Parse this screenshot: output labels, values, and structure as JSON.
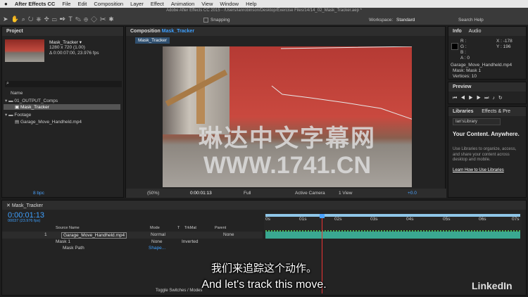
{
  "menubar": {
    "apple": "",
    "app": "After Effects CC",
    "items": [
      "File",
      "Edit",
      "Composition",
      "Layer",
      "Effect",
      "Animation",
      "View",
      "Window",
      "Help"
    ]
  },
  "window_title": "Adobe After Effects CC 2015 - /Users/ianrobinson/Desktop/Exercise Files/14/14_02_Mask_Tracker.aep *",
  "toolbar": {
    "snapping": "Snapping",
    "workspace_label": "Workspace:",
    "workspace_value": "Standard",
    "search_help": "Search Help"
  },
  "project": {
    "title": "Project",
    "item_name": "Mask_Tracker ▾",
    "item_res": "1280 x 720 (1.00)",
    "item_time": "Δ 0:00:07:00, 23.976 fps",
    "search_placeholder": "⌕",
    "col_name": "Name",
    "tree": [
      "01_OUTPUT_Comps",
      "Mask_Tracker",
      "Footage",
      "Garage_Move_Handheld.mp4"
    ],
    "bpc": "8 bpc"
  },
  "composition": {
    "tab_label": "Composition",
    "tab_name": "Mask_Tracker",
    "breadcrumb": "Mask_Tracker",
    "zoom": "(50%)",
    "timecode": "0:00:01:13",
    "quality": "Full",
    "camera": "Active Camera",
    "views": "1 View",
    "exposure": "+0.0"
  },
  "info": {
    "tab_info": "Info",
    "tab_audio": "Audio",
    "r": "R :",
    "g": "G :",
    "b": "B :",
    "a": "A : 0",
    "x": "X : -178",
    "y": "Y : 196",
    "file": "Garage_Move_Handheld.mp4",
    "mask": "Mask: Mask 1",
    "vertices": "Vertices: 10"
  },
  "preview": {
    "title": "Preview"
  },
  "libraries": {
    "title": "Libraries",
    "tab2": "Effects & Pre",
    "library": "Ian'sLibrary",
    "heading": "Your Content. Anywhere.",
    "body": "Use Libraries to organize, access, and share your content across desktop and mobile.",
    "link": "Learn How to Use Libraries"
  },
  "timeline": {
    "tab": "Mask_Tracker",
    "timecode": "0:00:01:13",
    "frames": "00037 (23.976 fps)",
    "col_source": "Source Name",
    "col_mode": "Mode",
    "col_t": "T",
    "col_trkmat": "TrkMat",
    "col_parent": "Parent",
    "layer_num": "1",
    "layer_name": "Garage_Move_Handheld.mp4",
    "layer_mode": "Normal",
    "parent_value": "None",
    "mask_name": "Mask 1",
    "mask_mode": "None",
    "inverted": "Inverted",
    "mask_path": "Mask Path",
    "shape": "Shape...",
    "toggle": "Toggle Switches / Modes",
    "ruler": [
      "0s",
      "01s",
      "02s",
      "03s",
      "04s",
      "05s",
      "06s",
      "07s"
    ]
  },
  "watermark": {
    "line1": "琳达中文字幕网",
    "line2": "WWW.1741.CN"
  },
  "subtitles": {
    "zh": "我们来追踪这个动作。",
    "en": "And let's track this move."
  },
  "brand": "LinkedIn"
}
